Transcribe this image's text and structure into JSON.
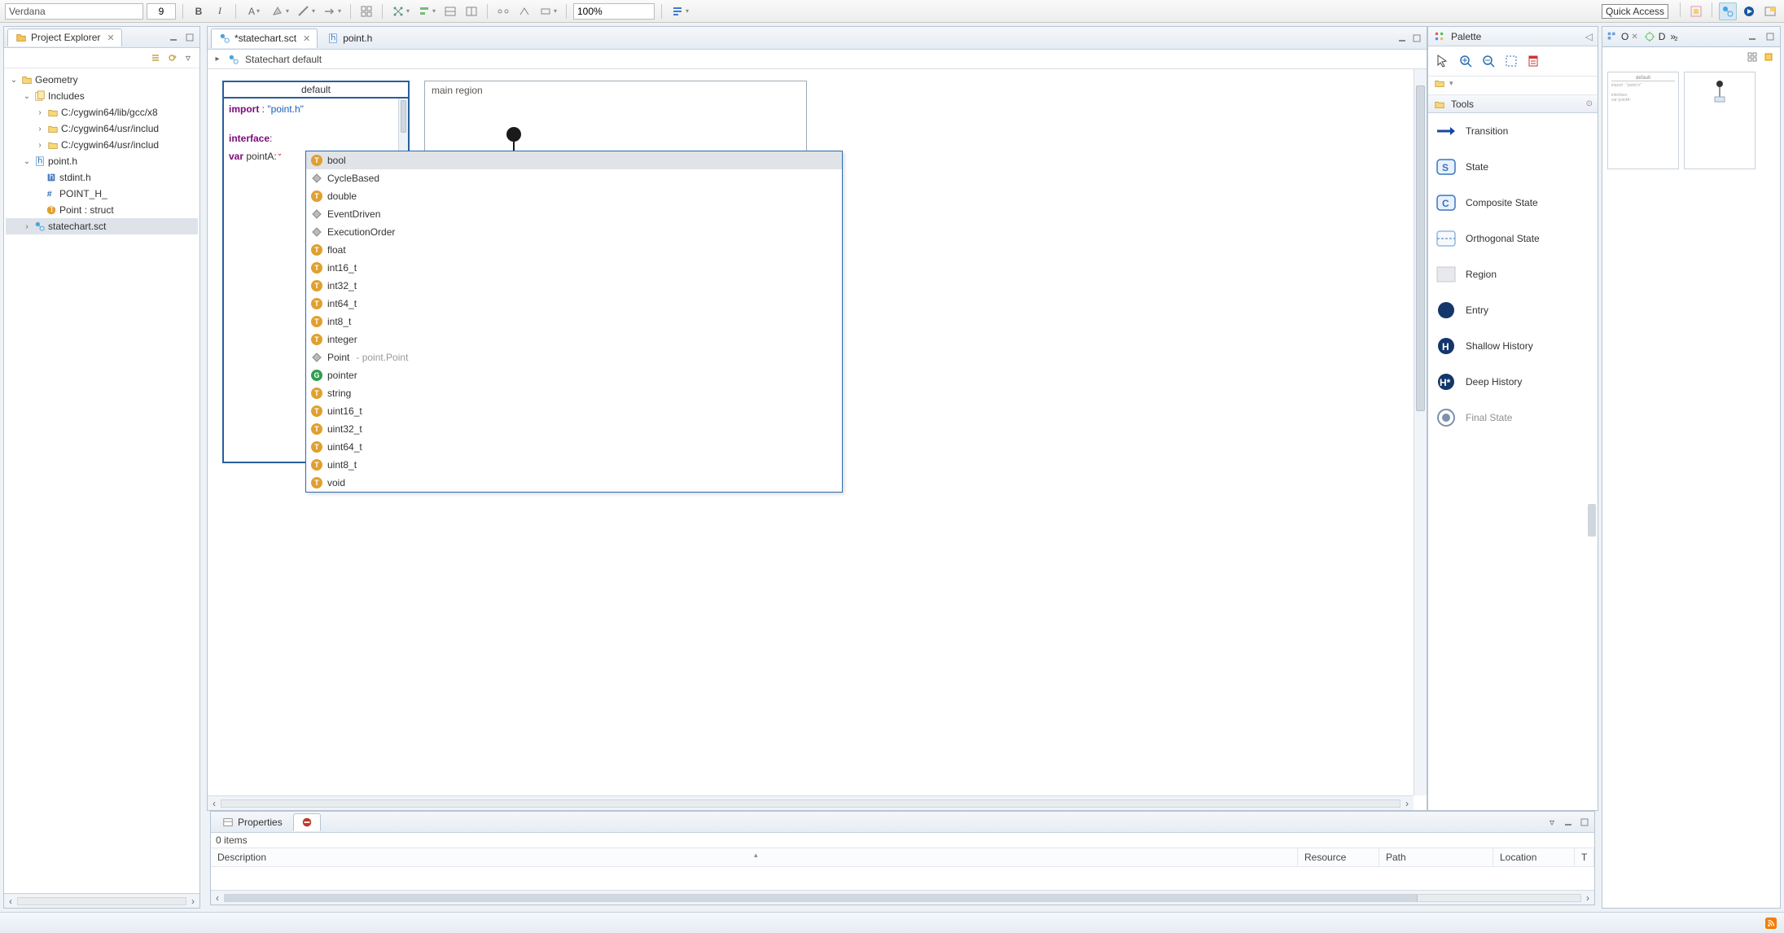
{
  "toolbar": {
    "font": "Verdana",
    "font_size": "9",
    "zoom": "100%",
    "quick_access": "Quick Access"
  },
  "project_explorer": {
    "title": "Project Explorer",
    "tree": {
      "root": "Geometry",
      "includes": "Includes",
      "inc1": "C:/cygwin64/lib/gcc/x8",
      "inc2": "C:/cygwin64/usr/includ",
      "inc3": "C:/cygwin64/usr/includ",
      "point_h": "point.h",
      "stdint_h": "stdint.h",
      "point_h_macro": "POINT_H_",
      "point_struct": "Point : struct",
      "statechart": "statechart.sct"
    }
  },
  "editor": {
    "tab1": "*statechart.sct",
    "tab2": "point.h",
    "breadcrumb": "Statechart default",
    "default_title": "default",
    "code_import_kw": "import",
    "code_import_sep": " : ",
    "code_import_str": "\"point.h\"",
    "code_interface_kw": "interface",
    "code_interface_colon": ":",
    "code_var_kw": "var",
    "code_var_name": " pointA:",
    "region_title": "main region"
  },
  "autocomplete": {
    "items": [
      {
        "icon": "t",
        "label": "bool",
        "hint": ""
      },
      {
        "icon": "d",
        "label": "CycleBased",
        "hint": ""
      },
      {
        "icon": "t",
        "label": "double",
        "hint": ""
      },
      {
        "icon": "d",
        "label": "EventDriven",
        "hint": ""
      },
      {
        "icon": "d",
        "label": "ExecutionOrder",
        "hint": ""
      },
      {
        "icon": "t",
        "label": "float",
        "hint": ""
      },
      {
        "icon": "t",
        "label": "int16_t",
        "hint": ""
      },
      {
        "icon": "t",
        "label": "int32_t",
        "hint": ""
      },
      {
        "icon": "t",
        "label": "int64_t",
        "hint": ""
      },
      {
        "icon": "t",
        "label": "int8_t",
        "hint": ""
      },
      {
        "icon": "t",
        "label": "integer",
        "hint": ""
      },
      {
        "icon": "d",
        "label": "Point",
        "hint": " - point.Point"
      },
      {
        "icon": "g",
        "label": "pointer",
        "hint": ""
      },
      {
        "icon": "t",
        "label": "string",
        "hint": ""
      },
      {
        "icon": "t",
        "label": "uint16_t",
        "hint": ""
      },
      {
        "icon": "t",
        "label": "uint32_t",
        "hint": ""
      },
      {
        "icon": "t",
        "label": "uint64_t",
        "hint": ""
      },
      {
        "icon": "t",
        "label": "uint8_t",
        "hint": ""
      },
      {
        "icon": "t",
        "label": "void",
        "hint": ""
      }
    ]
  },
  "palette": {
    "title": "Palette",
    "tools_section": "Tools",
    "items": {
      "transition": "Transition",
      "state": "State",
      "composite": "Composite State",
      "orthogonal": "Orthogonal State",
      "region": "Region",
      "entry": "Entry",
      "shallow": "Shallow History",
      "deep": "Deep History",
      "final": "Final State"
    }
  },
  "right_views": {
    "outline_label": "O",
    "debug_label": "D"
  },
  "bottom": {
    "properties_tab": "Properties",
    "items_count": "0 items",
    "col_description": "Description",
    "col_resource": "Resource",
    "col_path": "Path",
    "col_location": "Location",
    "col_type": "T"
  }
}
